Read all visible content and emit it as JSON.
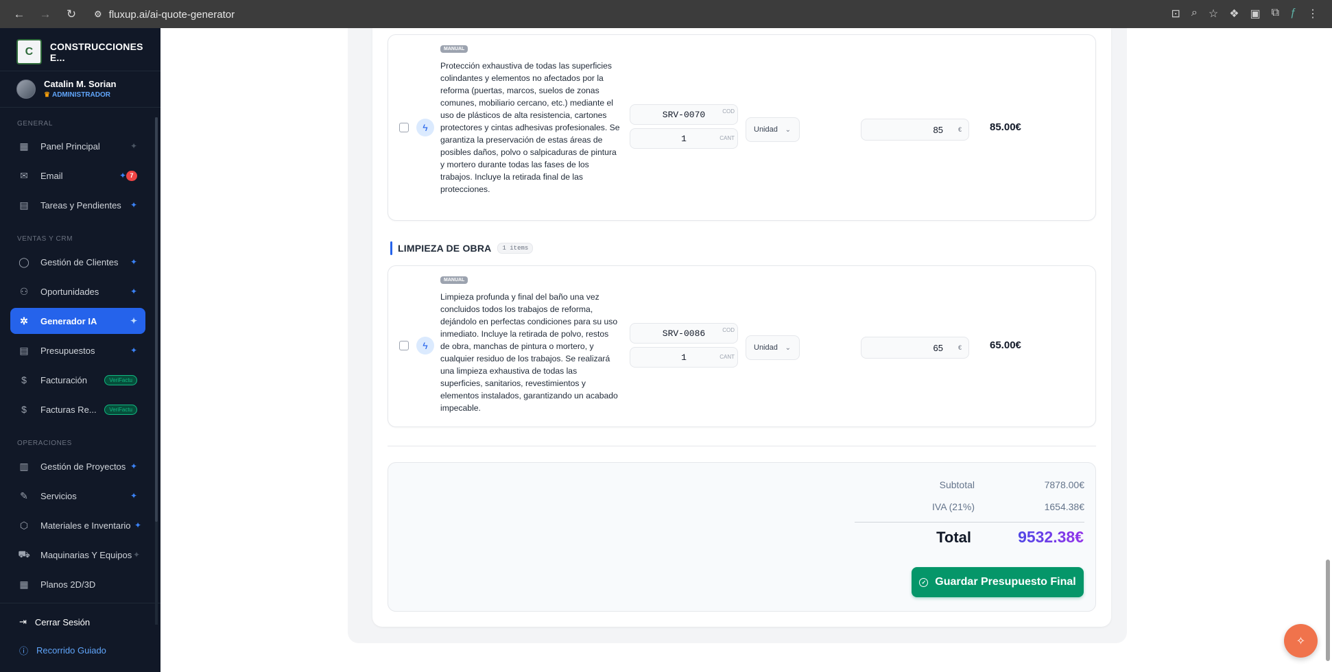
{
  "browser": {
    "url": "fluxup.ai/ai-quote-generator"
  },
  "sidebar": {
    "company": "CONSTRUCCIONES E...",
    "user": {
      "name": "Catalin M. Sorian",
      "role": "ADMINISTRADOR"
    },
    "sections": {
      "general": "GENERAL",
      "sales": "VENTAS Y CRM",
      "operations": "OPERACIONES"
    },
    "items": [
      {
        "label": "Panel Principal",
        "icon": "dashboard-icon"
      },
      {
        "label": "Email",
        "icon": "mail-icon",
        "badge": "7"
      },
      {
        "label": "Tareas y Pendientes",
        "icon": "clipboard-icon"
      },
      {
        "label": "Gestión de Clientes",
        "icon": "user-icon"
      },
      {
        "label": "Oportunidades",
        "icon": "users-icon"
      },
      {
        "label": "Generador IA",
        "icon": "ai-sparkle-icon",
        "active": true
      },
      {
        "label": "Presupuestos",
        "icon": "document-icon"
      },
      {
        "label": "Facturación",
        "icon": "invoice-icon",
        "badge": "VeriFactu"
      },
      {
        "label": "Facturas Re...",
        "icon": "invoice-icon",
        "badge": "VeriFactu"
      },
      {
        "label": "Gestión de Proyectos",
        "icon": "building-icon"
      },
      {
        "label": "Servicios",
        "icon": "wrench-icon"
      },
      {
        "label": "Materiales e Inventario",
        "icon": "box-icon"
      },
      {
        "label": "Maquinarias Y Equipos",
        "icon": "truck-icon"
      },
      {
        "label": "Planos 2D/3D",
        "icon": "grid-icon"
      }
    ],
    "footer": {
      "logout": "Cerrar Sesión",
      "tour": "Recorrido Guiado"
    }
  },
  "items": [
    {
      "tag": "MANUAL",
      "description": "Protección exhaustiva de todas las superficies colindantes y elementos no afectados por la reforma (puertas, marcos, suelos de zonas comunes, mobiliario cercano, etc.) mediante el uso de plásticos de alta resistencia, cartones protectores y cintas adhesivas profesionales. Se garantiza la preservación de estas áreas de posibles daños, polvo o salpicaduras de pintura y mortero durante todas las fases de los trabajos. Incluye la retirada final de las protecciones.",
      "code": "SRV-0070",
      "code_tag": "COD",
      "qty": "1",
      "qty_tag": "CANT",
      "unit": "Unidad",
      "price": "85",
      "currency": "€",
      "total": "85.00€"
    },
    {
      "tag": "MANUAL",
      "description": "Limpieza profunda y final del baño una vez concluidos todos los trabajos de reforma, dejándolo en perfectas condiciones para su uso inmediato. Incluye la retirada de polvo, restos de obra, manchas de pintura o mortero, y cualquier residuo de los trabajos. Se realizará una limpieza exhaustiva de todas las superficies, sanitarios, revestimientos y elementos instalados, garantizando un acabado impecable.",
      "code": "SRV-0086",
      "code_tag": "COD",
      "qty": "1",
      "qty_tag": "CANT",
      "unit": "Unidad",
      "price": "65",
      "currency": "€",
      "total": "65.00€"
    }
  ],
  "category": {
    "title": "LIMPIEZA DE OBRA",
    "count": "1 items"
  },
  "summary": {
    "subtotal_label": "Subtotal",
    "subtotal": "7878.00€",
    "iva_label": "IVA (21%)",
    "iva": "1654.38€",
    "total_label": "Total",
    "total": "9532.38€",
    "save_label": "Guardar Presupuesto Final"
  },
  "colors": {
    "accent": "#2563eb",
    "save": "#059669",
    "fab": "#f0734c"
  }
}
